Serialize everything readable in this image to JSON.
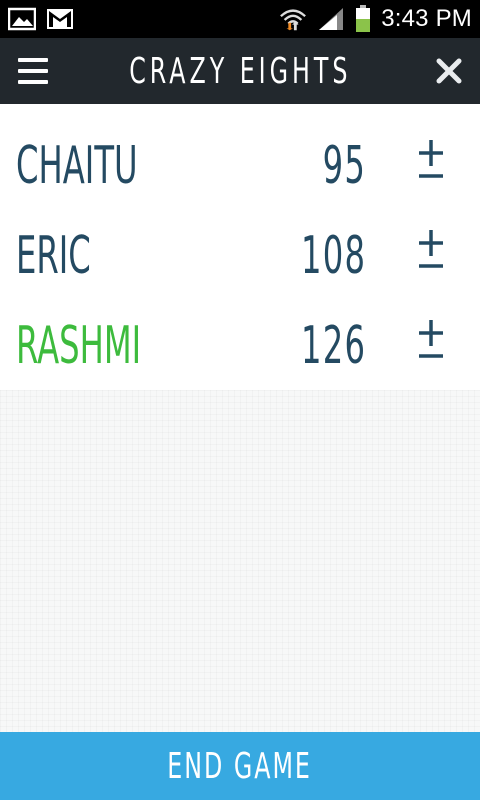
{
  "status_bar": {
    "time": "3:43 PM",
    "icons": [
      "gallery-icon",
      "gmail-icon",
      "wifi-icon",
      "signal-icon",
      "battery-icon"
    ]
  },
  "app_bar": {
    "title": "CRAZY EIGHTS",
    "menu_icon": "menu-icon",
    "close_icon": "close-icon"
  },
  "players": [
    {
      "name": "CHAITU",
      "score": "95",
      "adjust_icon": "plus-minus-icon"
    },
    {
      "name": "ERIC",
      "score": "108",
      "adjust_icon": "plus-minus-icon"
    },
    {
      "name": "RASHMI",
      "score": "126",
      "adjust_icon": "plus-minus-icon",
      "highlight": true
    }
  ],
  "footer": {
    "end_game_label": "END GAME"
  },
  "colors": {
    "app_bar_bg": "#22282d",
    "text_primary": "#244a62",
    "text_winner": "#3dbb3d",
    "accent": "#37a9e1"
  }
}
